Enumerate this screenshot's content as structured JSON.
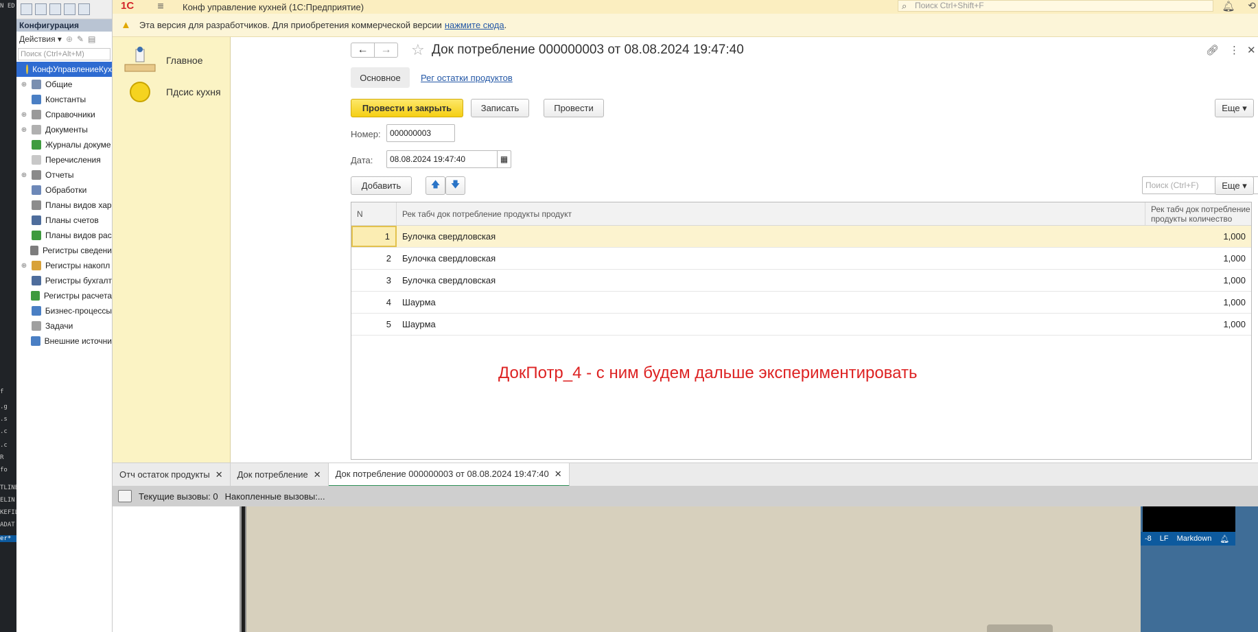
{
  "app": {
    "logo": "1С",
    "title": "Конф управление кухней  (1С:Предприятие)",
    "search_placeholder": "Поиск Ctrl+Shift+F"
  },
  "warning": {
    "text": "Эта версия для разработчиков. Для приобретения коммерческой версии",
    "link": "нажмите сюда",
    "suffix": "."
  },
  "configurator": {
    "title": "Конфигурация",
    "actions_label": "Действия ▾",
    "search_placeholder": "Поиск (Ctrl+Alt+M)",
    "tree": [
      {
        "label": "КонфУправлениеКух",
        "icon": "config-root-icon",
        "color": "#e5c33a"
      },
      {
        "label": "Общие",
        "icon": "common-icon",
        "color": "#7a8fb0"
      },
      {
        "label": "Константы",
        "icon": "constants-icon",
        "color": "#4a7fc4"
      },
      {
        "label": "Справочники",
        "icon": "catalogs-icon",
        "color": "#9a9a9a"
      },
      {
        "label": "Документы",
        "icon": "documents-icon",
        "color": "#b0b0b0"
      },
      {
        "label": "Журналы докуме",
        "icon": "journals-icon",
        "color": "#3f9c3f"
      },
      {
        "label": "Перечисления",
        "icon": "enums-icon",
        "color": "#c8c8c8"
      },
      {
        "label": "Отчеты",
        "icon": "reports-icon",
        "color": "#8a8a8a"
      },
      {
        "label": "Обработки",
        "icon": "processing-icon",
        "color": "#6d88b8"
      },
      {
        "label": "Планы видов хар",
        "icon": "chart-types-icon",
        "color": "#8c8c8c"
      },
      {
        "label": "Планы счетов",
        "icon": "accounts-icon",
        "color": "#4e6d9c"
      },
      {
        "label": "Планы видов рас",
        "icon": "calc-types-icon",
        "color": "#3e9a3e"
      },
      {
        "label": "Регистры сведени",
        "icon": "info-registers-icon",
        "color": "#7d7d7d"
      },
      {
        "label": "Регистры накопл",
        "icon": "accum-registers-icon",
        "color": "#d8a23a"
      },
      {
        "label": "Регистры бухгалт",
        "icon": "acc-registers-icon",
        "color": "#4e6d9c"
      },
      {
        "label": "Регистры расчета",
        "icon": "calc-registers-icon",
        "color": "#3e9a3e"
      },
      {
        "label": "Бизнес-процессы",
        "icon": "business-process-icon",
        "color": "#4a7fc4"
      },
      {
        "label": "Задачи",
        "icon": "tasks-icon",
        "color": "#a0a0a0"
      },
      {
        "label": "Внешние источни",
        "icon": "external-sources-icon",
        "color": "#4a7fc4"
      }
    ]
  },
  "sections": [
    {
      "label": "Главное",
      "icon": "home-desk-icon"
    },
    {
      "label": "Пдсис кухня",
      "icon": "kitchen-circle-icon"
    }
  ],
  "form": {
    "title": "Док потребление 000000003 от 08.08.2024 19:47:40",
    "tabs": {
      "main": "Основное",
      "link": "Рег остатки продуктов"
    },
    "buttons": {
      "post_close": "Провести и закрыть",
      "save": "Записать",
      "post": "Провести",
      "more": "Еще ▾",
      "add": "Добавить",
      "grid_more": "Еще ▾"
    },
    "number_label": "Номер:",
    "number_value": "000000003",
    "date_label": "Дата:",
    "date_value": "08.08.2024 19:47:40",
    "grid_search_placeholder": "Поиск (Ctrl+F)",
    "grid": {
      "columns": [
        "N",
        "Рек табч док потребление продукты продукт",
        "Рек табч док потребление продукты количество"
      ],
      "rows": [
        {
          "n": "1",
          "product": "Булочка свердловская",
          "qty": "1,000"
        },
        {
          "n": "2",
          "product": "Булочка свердловская",
          "qty": "1,000"
        },
        {
          "n": "3",
          "product": "Булочка свердловская",
          "qty": "1,000"
        },
        {
          "n": "4",
          "product": "Шаурма",
          "qty": "1,000"
        },
        {
          "n": "5",
          "product": "Шаурма",
          "qty": "1,000"
        }
      ]
    },
    "annotation": "ДокПотр_4 - с ним будем дальше экспериментировать"
  },
  "open_tabs": [
    {
      "label": "Отч остаток продукты",
      "active": false
    },
    {
      "label": "Док потребление",
      "active": false
    },
    {
      "label": "Док потребление 000000003 от 08.08.2024 19:47:40",
      "active": true
    }
  ],
  "status": {
    "current": "Текущие вызовы: 0",
    "accumulated": "Накопленные вызовы:..."
  },
  "background_editor": {
    "status_items": [
      "-8",
      "LF",
      "Markdown"
    ],
    "left_labels": [
      "N ED",
      "f",
      ".g",
      ".s",
      ".c",
      ".c",
      "R",
      "fo",
      "TLINE",
      "ELIN",
      "KEFIL",
      "ADAT",
      "er*"
    ]
  },
  "colors": {
    "accent_yellow": "#f5cf14",
    "section_bg": "#fbf3c4",
    "link": "#2357a6",
    "annotation": "#dd2222"
  }
}
